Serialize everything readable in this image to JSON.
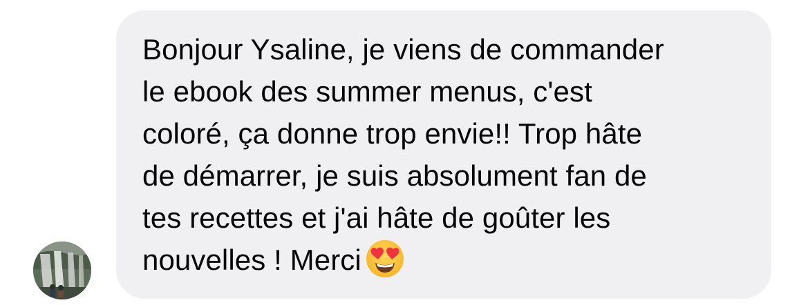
{
  "conversation": {
    "message": {
      "lines": [
        "Bonjour Ysaline, je viens de commander",
        "le ebook des summer menus, c'est",
        "coloré, ça donne trop envie!! Trop hâte",
        "de démarrer, je suis absolument fan de",
        "tes recettes et j'ai hâte de goûter les",
        "nouvelles ! Merci"
      ],
      "emoji": "heart-eyes-emoji"
    },
    "sender": {
      "avatar": "waterfall-photo-avatar"
    }
  },
  "colors": {
    "bubble_background": "#f0f0f2",
    "text": "#050505",
    "emoji_face": "#ffcb3b",
    "emoji_hearts": "#ef3340"
  }
}
